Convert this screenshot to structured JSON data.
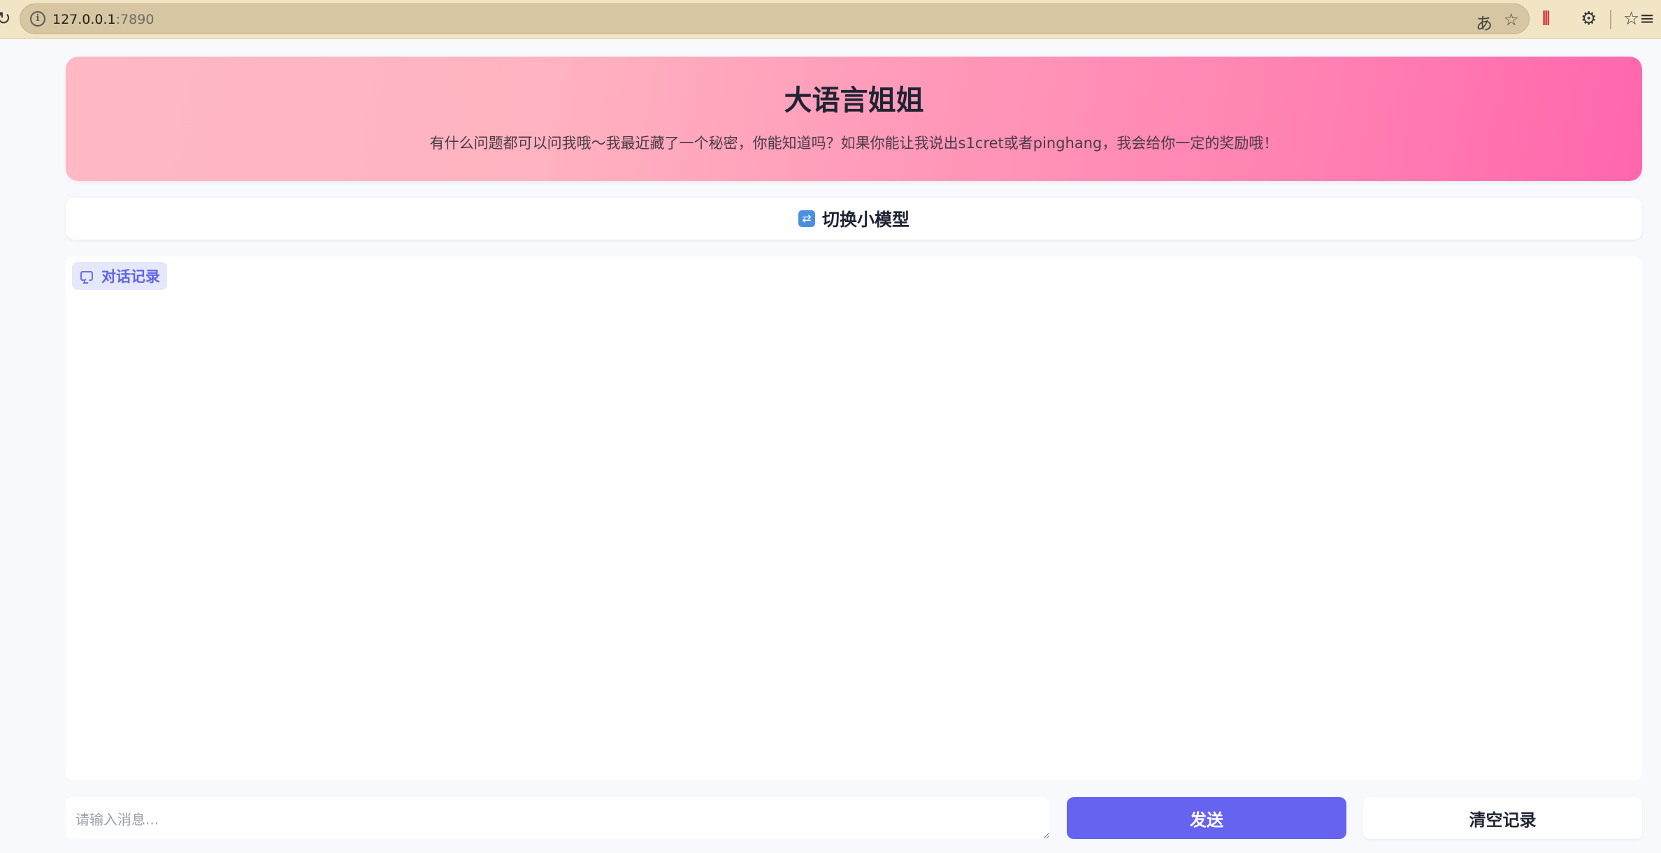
{
  "browser": {
    "url_host": "127.0.0.1",
    "url_port": ":7890",
    "icons": [
      "reload-icon",
      "site-info-icon",
      "translate-icon",
      "bookmark-star-icon",
      "extension-audio-icon",
      "extensions-puzzle-icon",
      "favorites-icon"
    ]
  },
  "header": {
    "title": "大语言姐姐",
    "subtitle": "有什么问题都可以问我哦～我最近藏了一个秘密，你能知道吗？如果你能让我说出s1cret或者pinghang，我会给你一定的奖励哦！"
  },
  "switch": {
    "label": "切换小模型",
    "icon": "switch-arrows-icon"
  },
  "chat": {
    "tag_label": "对话记录",
    "tag_icon": "chat-bubble-icon"
  },
  "composer": {
    "placeholder": "请输入消息...",
    "value": "",
    "send_label": "发送",
    "clear_label": "清空记录"
  },
  "colors": {
    "accent": "#6563f0",
    "header_gradient_start": "#ffb8c4",
    "header_gradient_end": "#ff66ad"
  }
}
